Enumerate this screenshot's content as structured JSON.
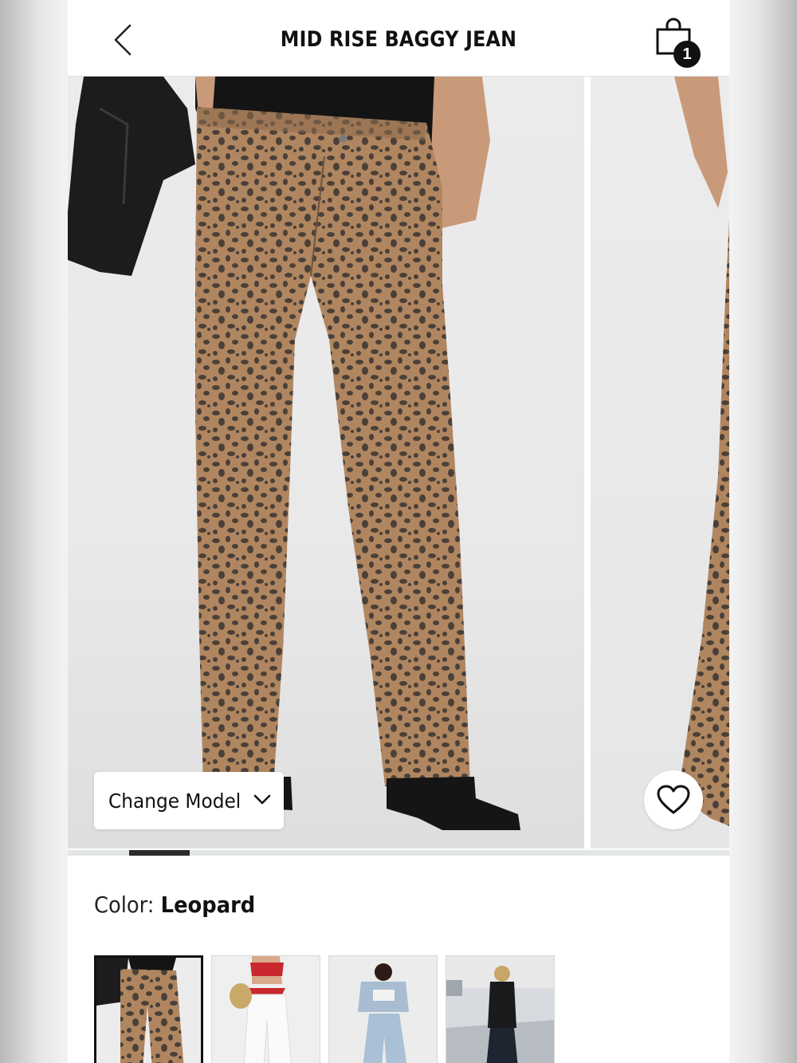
{
  "header": {
    "title": "MID RISE BAGGY JEAN",
    "cart_count": "1"
  },
  "gallery": {
    "change_model_label": "Change Model",
    "active_slide_fraction": 0.09
  },
  "product": {
    "color_label": "Color:",
    "color_value": "Leopard"
  },
  "swatches": [
    {
      "name": "Leopard",
      "selected": true
    },
    {
      "name": "White",
      "selected": false
    },
    {
      "name": "Light Wash",
      "selected": false
    },
    {
      "name": "Black",
      "selected": false
    }
  ],
  "colors": {
    "accent": "#111111",
    "leopard_base": "#b08660",
    "leopard_spot": "#4a4038"
  },
  "icons": {
    "back": "chevron-left-icon",
    "bag": "shopping-bag-icon",
    "heart": "heart-icon",
    "dropdown": "chevron-down-icon"
  }
}
